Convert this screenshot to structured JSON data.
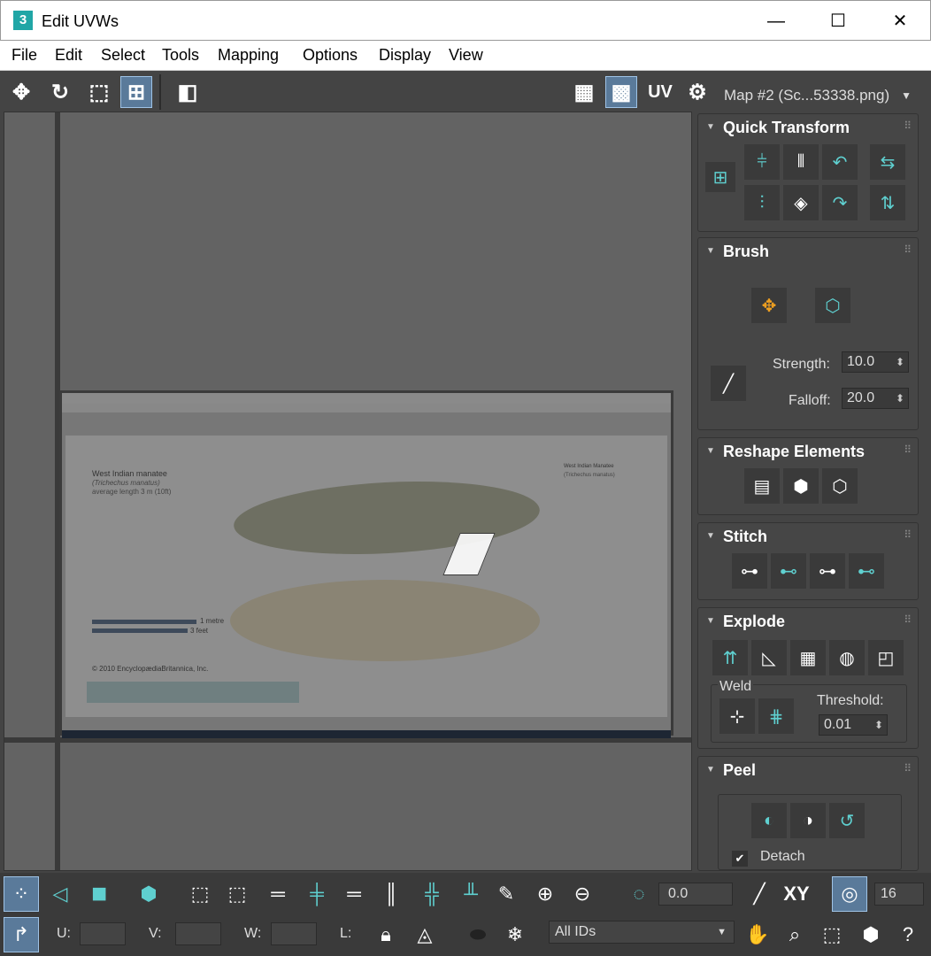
{
  "window": {
    "title": "Edit UVWs",
    "app_icon": "3",
    "minimize": "—",
    "maximize": "☐",
    "close": "✕"
  },
  "menu": [
    "File",
    "Edit",
    "Select",
    "Tools",
    "Mapping",
    "Options",
    "Display",
    "View"
  ],
  "toolbar": {
    "uv_label": "UV",
    "map_select": "Map #2 (Sc...53338.png)"
  },
  "texture": {
    "heading": "West Indian manatee",
    "species": "(Trichechus manatus)",
    "length": "average length 3 m (10ft)",
    "scale_metre": "1 metre",
    "scale_feet": "3 feet",
    "copyright": "© 2010 EncyclopædiaBritannica, Inc.",
    "side_title": "West Indian Manatee",
    "side_species": "(Trichechus manatus)"
  },
  "panel": {
    "quick_transform": {
      "title": "Quick Transform"
    },
    "brush": {
      "title": "Brush",
      "strength_label": "Strength:",
      "strength": "10.0",
      "falloff_label": "Falloff:",
      "falloff": "20.0"
    },
    "reshape": {
      "title": "Reshape Elements"
    },
    "stitch": {
      "title": "Stitch"
    },
    "explode": {
      "title": "Explode",
      "weld_label": "Weld",
      "threshold_label": "Threshold:",
      "threshold": "0.01"
    },
    "peel": {
      "title": "Peel",
      "detach_label": "Detach"
    }
  },
  "bottom": {
    "angle_value": "0.0",
    "xy_label": "XY",
    "grid_value": "16",
    "u_label": "U:",
    "v_label": "V:",
    "w_label": "W:",
    "l_label": "L:",
    "ids_select": "All IDs"
  },
  "colors": {
    "accent": "#5fd0d0",
    "bg": "#444444",
    "viewport": "#636363"
  }
}
